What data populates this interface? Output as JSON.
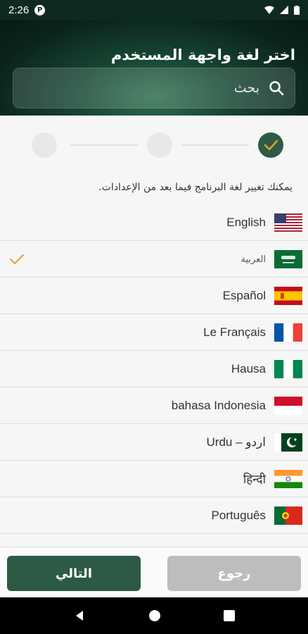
{
  "status_bar": {
    "time": "2:26",
    "pill_letter": "P"
  },
  "header": {
    "title": "اختر لغة واجهة المستخدم",
    "search_placeholder": "بحث"
  },
  "hint": "يمكنك تغيير لغة البرنامج فيما بعد من الإعدادات.",
  "languages": [
    {
      "label": "English",
      "flag": "us-flag-icon",
      "selected": false
    },
    {
      "label": "العربية",
      "flag": "saudi-flag-icon",
      "selected": true
    },
    {
      "label": "Español",
      "flag": "spain-flag-icon",
      "selected": false
    },
    {
      "label": "Le Français",
      "flag": "france-flag-icon",
      "selected": false
    },
    {
      "label": "Hausa",
      "flag": "nigeria-flag-icon",
      "selected": false
    },
    {
      "label": "bahasa Indonesia",
      "flag": "indonesia-flag-icon",
      "selected": false
    },
    {
      "label": "Urdu – اردو",
      "flag": "pakistan-flag-icon",
      "selected": false
    },
    {
      "label": "हिन्दी",
      "flag": "india-flag-icon",
      "selected": false
    },
    {
      "label": "Português",
      "flag": "portugal-flag-icon",
      "selected": false
    }
  ],
  "footer": {
    "next_label": "التالي",
    "back_label": "رجوع"
  },
  "colors": {
    "primary": "#2c5a45",
    "check": "#e0a030",
    "disabled": "#bdbdbd"
  }
}
